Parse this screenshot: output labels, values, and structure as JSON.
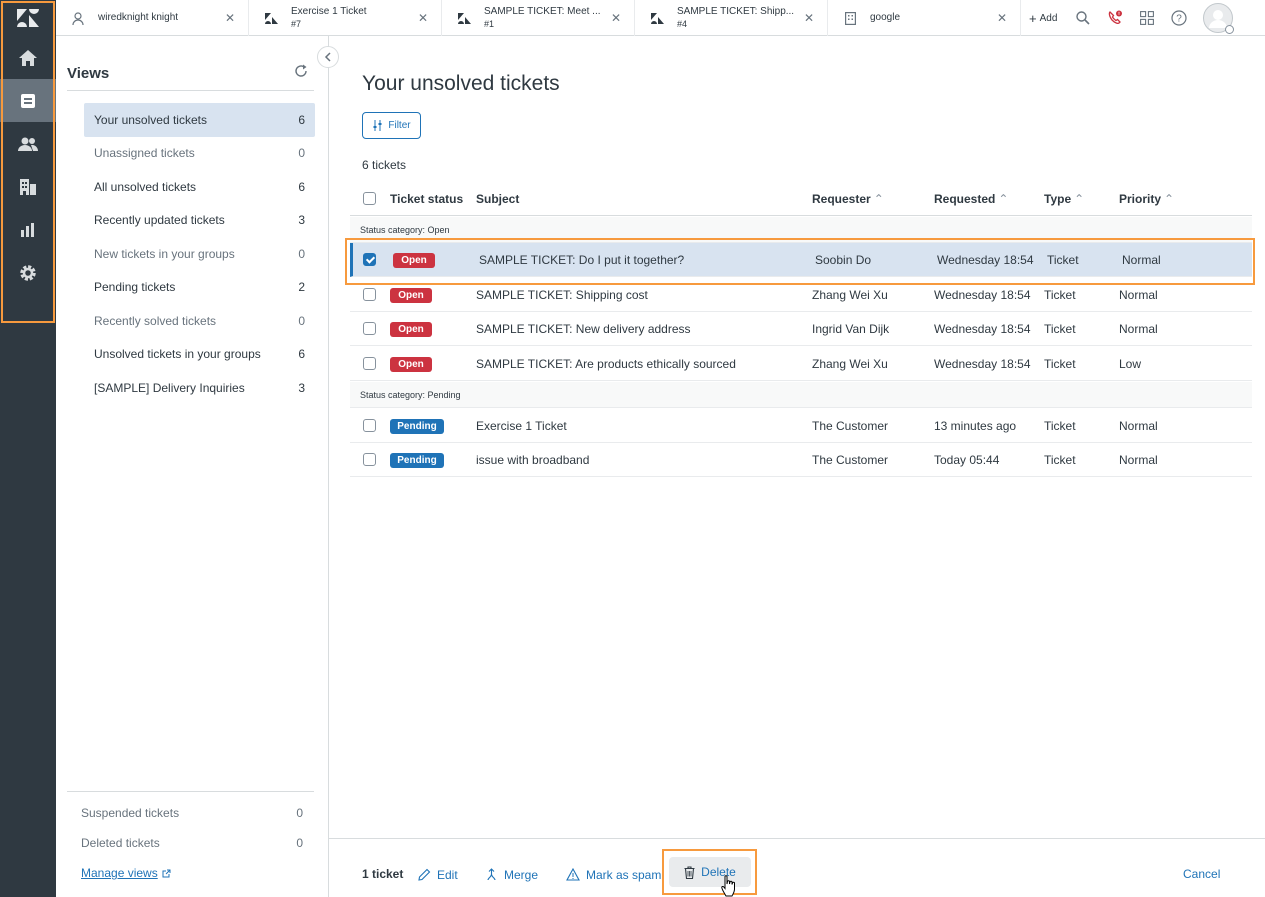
{
  "tabs": [
    {
      "title": "wiredknight knight",
      "subtitle": "",
      "icon": "user-icon"
    },
    {
      "title": "Exercise 1 Ticket",
      "subtitle": "#7",
      "icon": "ticket-icon"
    },
    {
      "title": "SAMPLE TICKET: Meet ...",
      "subtitle": "#1",
      "icon": "ticket-icon"
    },
    {
      "title": "SAMPLE TICKET: Shipp...",
      "subtitle": "#4",
      "icon": "ticket-icon"
    },
    {
      "title": "google",
      "subtitle": "",
      "icon": "building-icon"
    }
  ],
  "topbar": {
    "add_label": "Add"
  },
  "views": {
    "title": "Views",
    "items": [
      {
        "label": "Your unsolved tickets",
        "count": "6"
      },
      {
        "label": "Unassigned tickets",
        "count": "0"
      },
      {
        "label": "All unsolved tickets",
        "count": "6"
      },
      {
        "label": "Recently updated tickets",
        "count": "3"
      },
      {
        "label": "New tickets in your groups",
        "count": "0"
      },
      {
        "label": "Pending tickets",
        "count": "2"
      },
      {
        "label": "Recently solved tickets",
        "count": "0"
      },
      {
        "label": "Unsolved tickets in your groups",
        "count": "6"
      },
      {
        "label": "[SAMPLE] Delivery Inquiries",
        "count": "3"
      }
    ],
    "bottom": [
      {
        "label": "Suspended tickets",
        "count": "0"
      },
      {
        "label": "Deleted tickets",
        "count": "0"
      }
    ],
    "manage_label": "Manage views"
  },
  "main": {
    "title": "Your unsolved tickets",
    "filter_label": "Filter",
    "count_label": "6 tickets",
    "columns": {
      "status": "Ticket status",
      "subject": "Subject",
      "requester": "Requester",
      "requested": "Requested",
      "type": "Type",
      "priority": "Priority"
    },
    "groups": [
      {
        "label": "Status category: Open"
      },
      {
        "label": "Status category: Pending"
      }
    ],
    "rows": [
      {
        "status": "Open",
        "subject": "SAMPLE TICKET: Do I put it together?",
        "requester": "Soobin Do",
        "requested": "Wednesday 18:54",
        "type": "Ticket",
        "priority": "Normal"
      },
      {
        "status": "Open",
        "subject": "SAMPLE TICKET: Shipping cost",
        "requester": "Zhang Wei Xu",
        "requested": "Wednesday 18:54",
        "type": "Ticket",
        "priority": "Normal"
      },
      {
        "status": "Open",
        "subject": "SAMPLE TICKET: New delivery address",
        "requester": "Ingrid Van Dijk",
        "requested": "Wednesday 18:54",
        "type": "Ticket",
        "priority": "Normal"
      },
      {
        "status": "Open",
        "subject": "SAMPLE TICKET: Are products ethically sourced",
        "requester": "Zhang Wei Xu",
        "requested": "Wednesday 18:54",
        "type": "Ticket",
        "priority": "Low"
      },
      {
        "status": "Pending",
        "subject": "Exercise 1 Ticket",
        "requester": "The Customer",
        "requested": "13 minutes ago",
        "type": "Ticket",
        "priority": "Normal"
      },
      {
        "status": "Pending",
        "subject": "issue with broadband",
        "requester": "The Customer",
        "requested": "Today 05:44",
        "type": "Ticket",
        "priority": "Normal"
      }
    ]
  },
  "actionbar": {
    "count": "1 ticket",
    "edit": "Edit",
    "merge": "Merge",
    "spam": "Mark as spam",
    "delete": "Delete",
    "cancel": "Cancel"
  },
  "colors": {
    "rail": "#2f3941",
    "accent": "#1f73b7",
    "open": "#cc3340",
    "highlight": "#f79a3e"
  }
}
